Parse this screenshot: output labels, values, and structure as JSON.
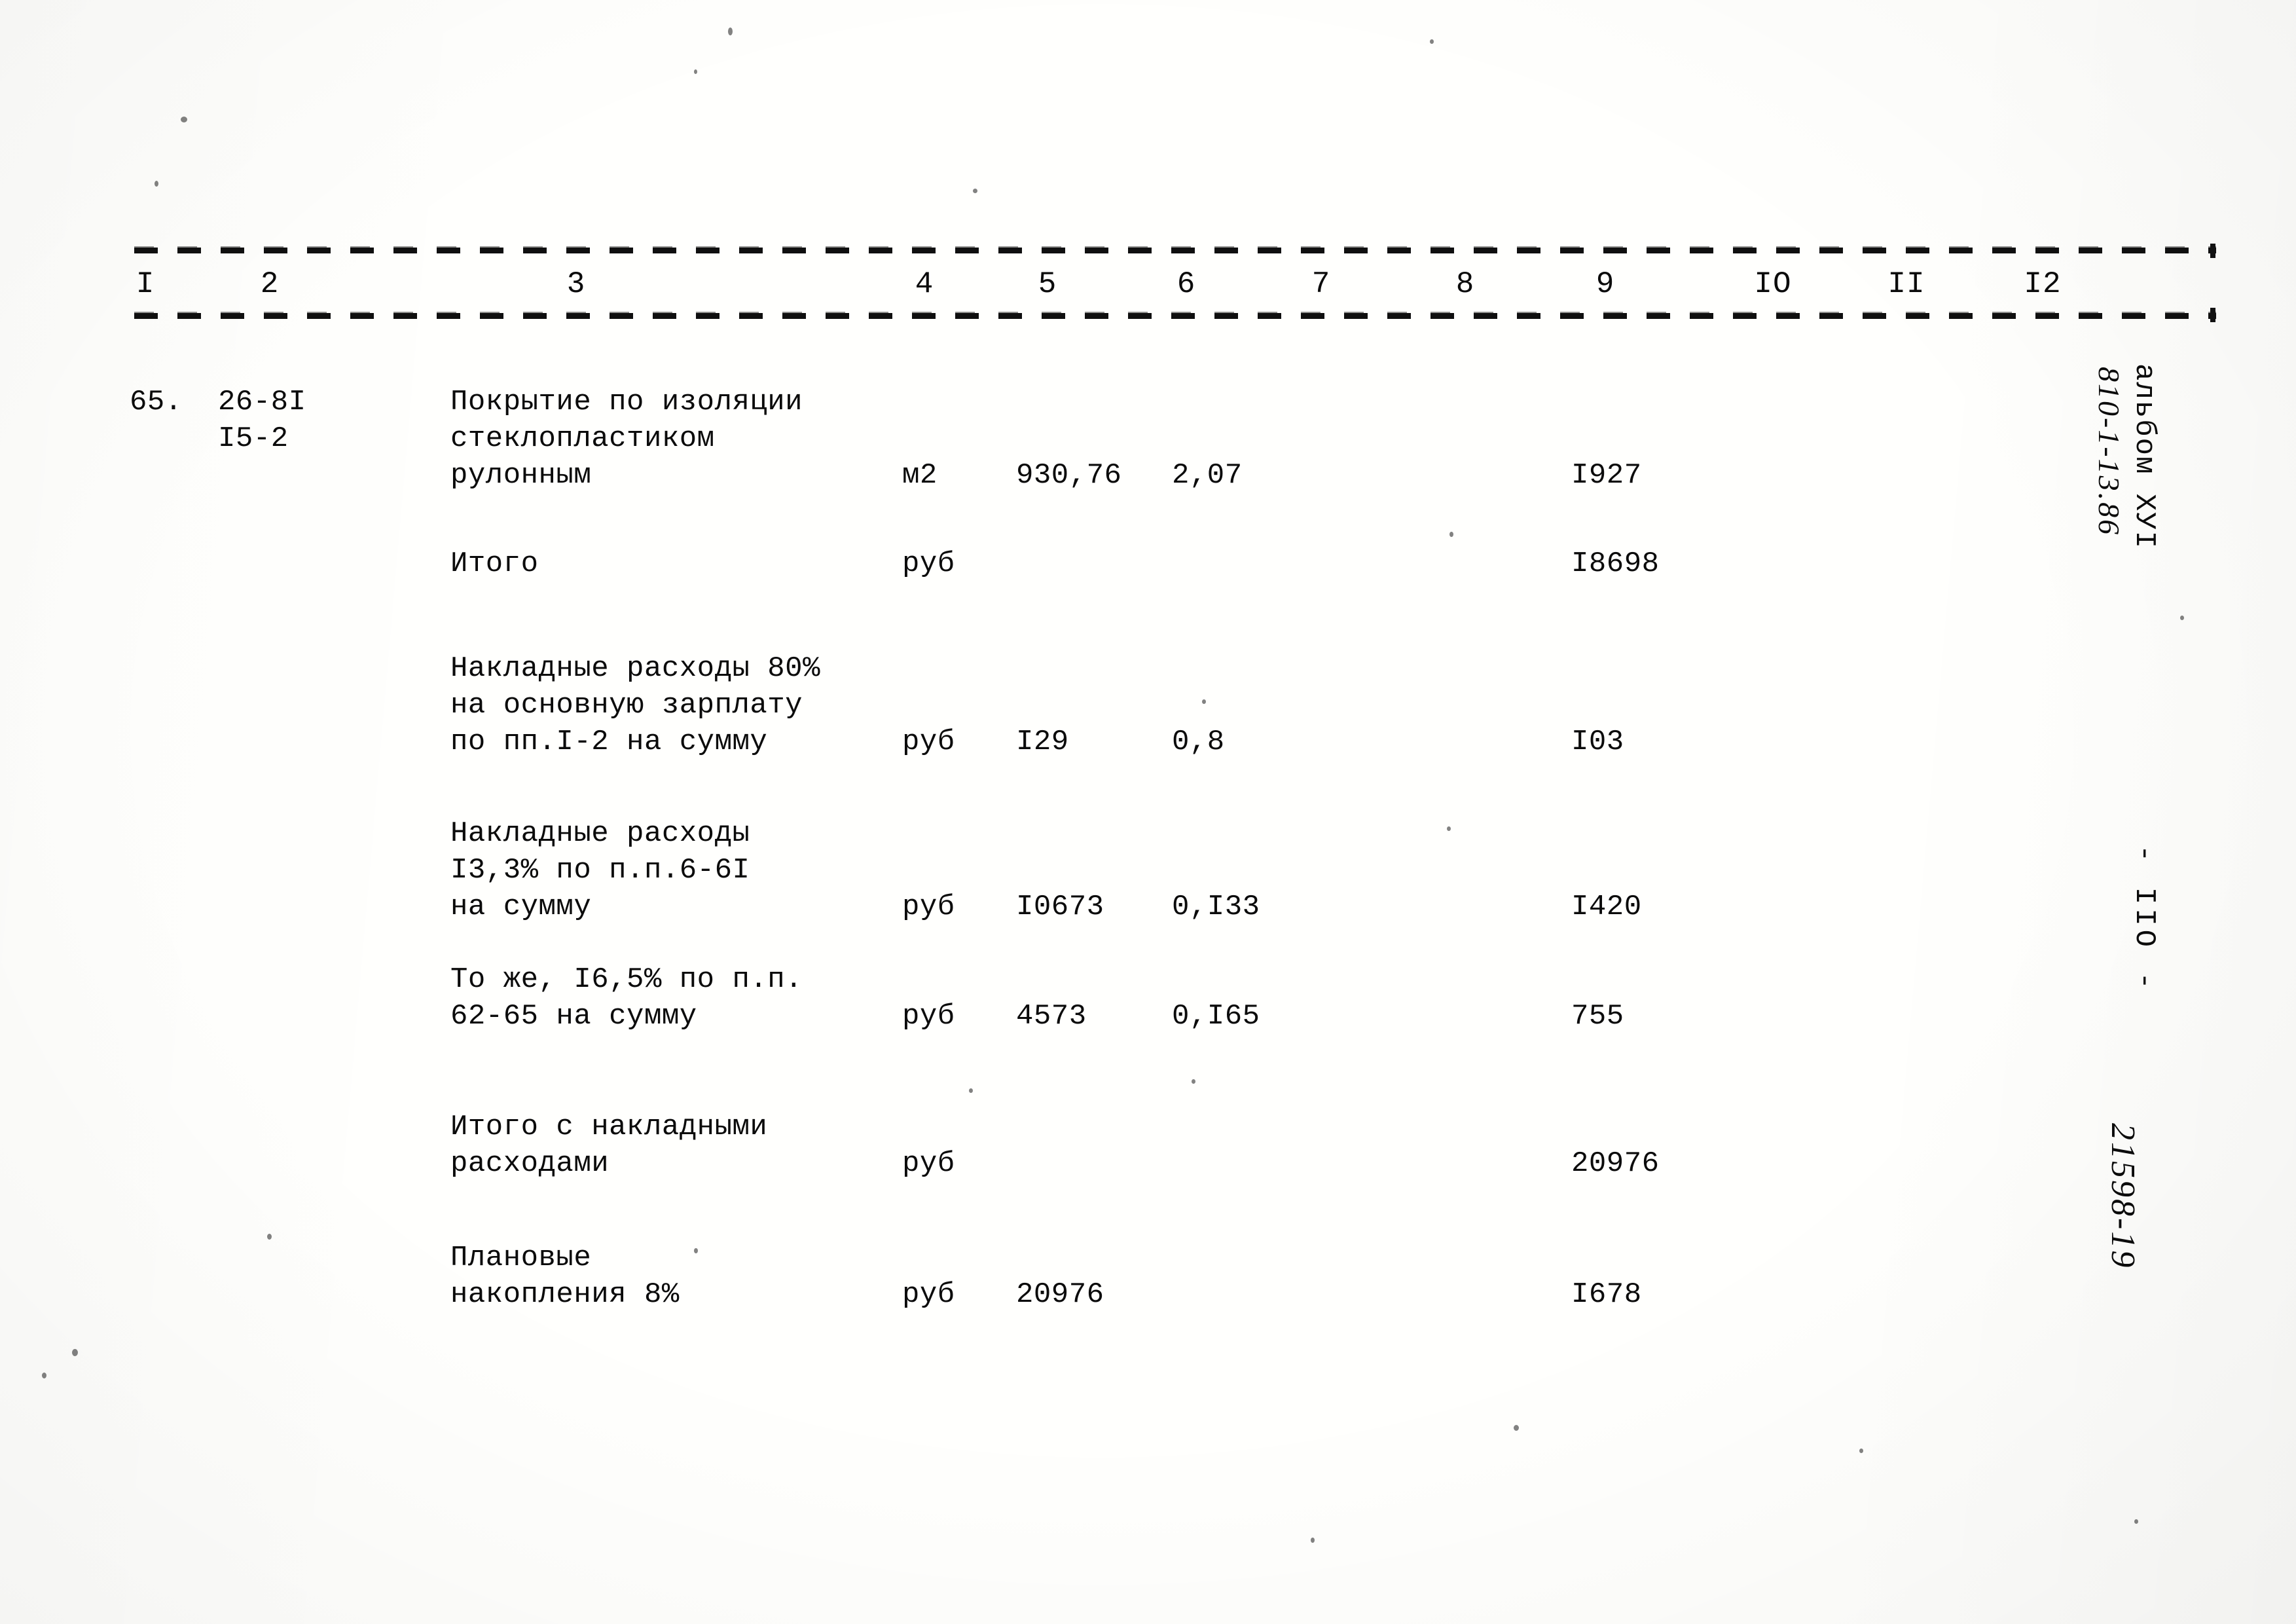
{
  "document": {
    "type": "scanned-cost-estimate-table",
    "language": "ru"
  },
  "table": {
    "column_headers": [
      "I",
      "2",
      "3",
      "4",
      "5",
      "6",
      "7",
      "8",
      "9",
      "IO",
      "II",
      "I2"
    ],
    "rows": [
      {
        "num": "65.",
        "code": "26-8I\nI5-2",
        "description": "Покрытие по изоляции\nстеклопластиком\nрулонным",
        "unit": "м2",
        "qty": "930,76",
        "rate": "2,07",
        "total": "I927"
      },
      {
        "num": "",
        "code": "",
        "description": "Итого",
        "unit": "руб",
        "qty": "",
        "rate": "",
        "total": "I8698"
      },
      {
        "num": "",
        "code": "",
        "description": "Накладные расходы 80%\nна основную зарплату\nпо пп.I-2 на сумму",
        "unit": "руб",
        "qty": "I29",
        "rate": "0,8",
        "total": "I03"
      },
      {
        "num": "",
        "code": "",
        "description": "Накладные расходы\nI3,3% по п.п.6-6I\nна сумму",
        "unit": "руб",
        "qty": "I0673",
        "rate": "0,I33",
        "total": "I420"
      },
      {
        "num": "",
        "code": "",
        "description": "То же, I6,5% по п.п.\n62-65 на сумму",
        "unit": "руб",
        "qty": "4573",
        "rate": "0,I65",
        "total": "755"
      },
      {
        "num": "",
        "code": "",
        "description": "Итого с накладными\nрасходами",
        "unit": "руб",
        "qty": "",
        "rate": "",
        "total": "20976"
      },
      {
        "num": "",
        "code": "",
        "description": "Плановые\nнакопления 8%",
        "unit": "руб",
        "qty": "20976",
        "rate": "",
        "total": "I678"
      }
    ]
  },
  "margin": {
    "album_label": "альбом ХУI",
    "album_code": "810-1-13.86",
    "page_number": "- IIO -",
    "doc_stamp": "21598-19"
  }
}
